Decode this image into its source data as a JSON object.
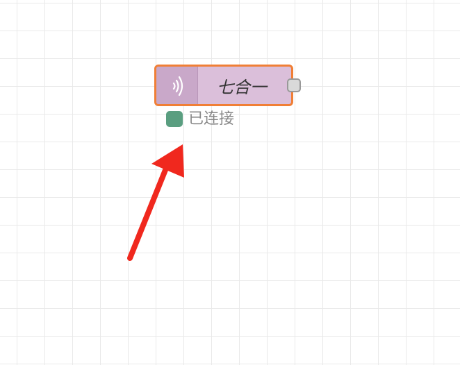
{
  "node": {
    "label": "七合一",
    "icon": "signal-waves-icon",
    "fill_color": "#dbbfda",
    "icon_area_color": "#c9a8c9",
    "border_color": "#f07f36"
  },
  "status": {
    "text": "已连接",
    "color": "#5a9e80"
  },
  "annotation": {
    "color": "#f0281e"
  }
}
